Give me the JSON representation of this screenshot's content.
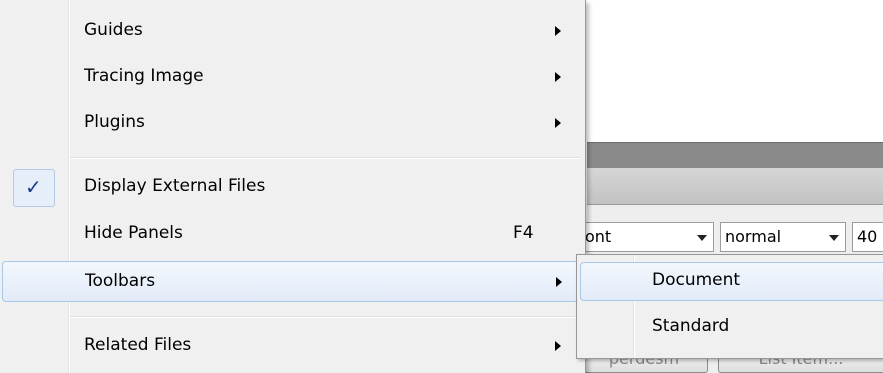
{
  "menu": {
    "items": [
      {
        "label": "Guides",
        "submenu": true
      },
      {
        "label": "Tracing Image",
        "submenu": true
      },
      {
        "label": "Plugins",
        "submenu": true
      },
      {
        "label": "Display External Files",
        "checked": true
      },
      {
        "label": "Hide Panels",
        "shortcut": "F4"
      },
      {
        "label": "Toolbars",
        "submenu": true,
        "highlighted": true
      },
      {
        "label": "Related Files",
        "submenu": true
      }
    ]
  },
  "submenu": {
    "items": [
      {
        "label": "Document",
        "highlighted": true
      },
      {
        "label": "Standard"
      }
    ]
  },
  "background": {
    "font_select": "ont",
    "weight_select": "normal",
    "size_select": "40",
    "button_left": "perdesm",
    "button_right": "List Item..."
  },
  "colors": {
    "highlight_border": "#a8c8ea",
    "menu_background": "#f0f0f0",
    "check_mark": "#1b3f8e"
  },
  "icons": {
    "check": "checkmark-icon",
    "submenu_arrow": "submenu-arrow-icon",
    "dropdown_arrow": "dropdown-arrow-icon"
  }
}
